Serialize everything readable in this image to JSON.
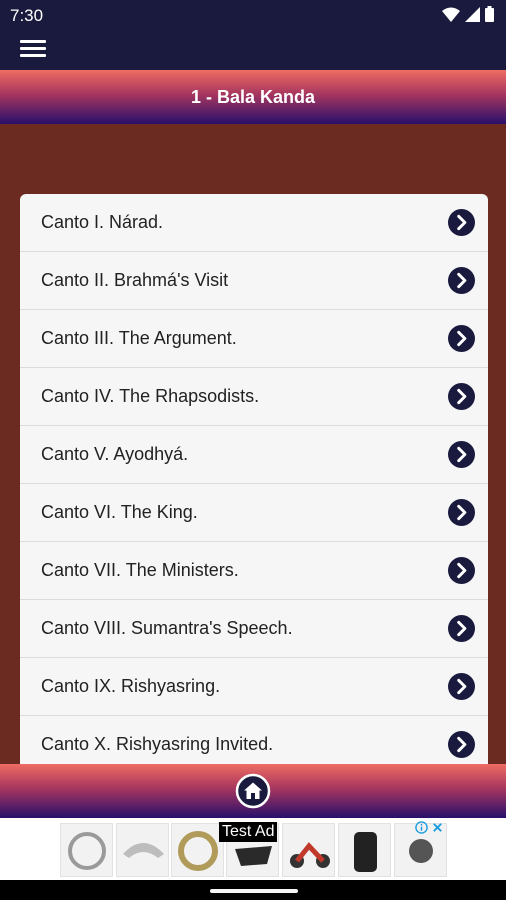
{
  "status_bar": {
    "time": "7:30"
  },
  "header": {
    "title": "1 - Bala Kanda"
  },
  "cantos": [
    {
      "label": "Canto I. Nárad."
    },
    {
      "label": "Canto II. Brahmá's Visit"
    },
    {
      "label": "Canto III. The Argument."
    },
    {
      "label": "Canto IV. The Rhapsodists."
    },
    {
      "label": "Canto V. Ayodhyá."
    },
    {
      "label": "Canto VI. The King."
    },
    {
      "label": "Canto VII. The Ministers."
    },
    {
      "label": "Canto VIII. Sumantra's Speech."
    },
    {
      "label": "Canto IX. Rishyasring."
    },
    {
      "label": "Canto X. Rishyasring Invited."
    }
  ],
  "ad": {
    "label": "Test Ad"
  },
  "colors": {
    "accent": "#1a1a3e",
    "content_bg": "#6c2b20",
    "card_bg": "#f6f6f6"
  }
}
